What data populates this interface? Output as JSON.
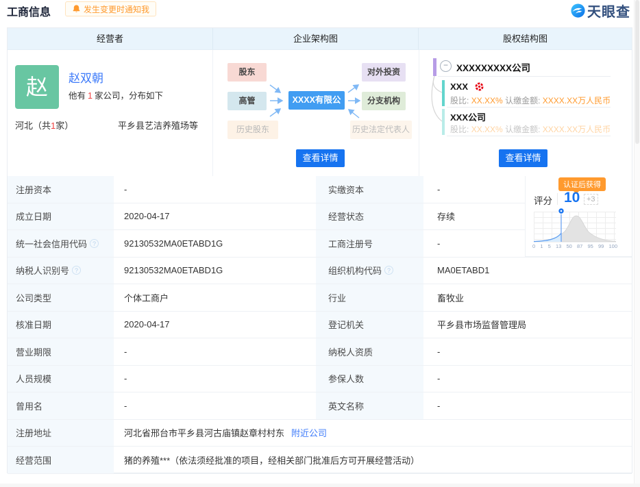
{
  "page": {
    "title": "工商信息",
    "notify_label": "发生变更时通知我",
    "logo_text": "天眼查"
  },
  "colors": {
    "accent_blue": "#1673f0",
    "link_blue": "#3e7bfa",
    "orange": "#ff9a2e",
    "avatar_green": "#68c6a2",
    "red": "#f04040",
    "header_bg": "#e9f4fc"
  },
  "headers": {
    "operator": "经营者",
    "org_chart": "企业架构图",
    "equity_chart": "股权结构图"
  },
  "operator": {
    "avatar_char": "赵",
    "name": "赵双朝",
    "desc_prefix": "他有",
    "desc_count": "1",
    "desc_suffix": "家公司，分布如下",
    "region_prefix": "河北（共",
    "region_count": "1",
    "region_suffix": "家）",
    "company": "平乡县艺洁养殖场等"
  },
  "org": {
    "left": [
      "股东",
      "高管",
      "历史股东"
    ],
    "center": "XXXX有限公司",
    "right": [
      "对外投资",
      "分支机构",
      "历史法定代表人"
    ],
    "detail_button": "查看详情"
  },
  "equity": {
    "root": "XXXXXXXXX公司",
    "children": [
      {
        "name": "XXX",
        "has_red_icon": true,
        "ratio_label": "股比:",
        "ratio": "XX.XX%",
        "amount_label": "认缴金额:",
        "amount": "XXXX.XX万人民币",
        "faded": false
      },
      {
        "name": "XXX公司",
        "has_red_icon": false,
        "ratio_label": "股比:",
        "ratio": "XX.XX%",
        "amount_label": "认缴金额:",
        "amount": "XXXX.XX万人民币",
        "faded": true
      }
    ],
    "detail_button": "查看详情"
  },
  "score": {
    "badge": "认证后获得",
    "label": "评分",
    "value": "10",
    "bonus": "+3",
    "axis": [
      "0",
      "1",
      "5",
      "13",
      "50",
      "87",
      "95",
      "99",
      "100"
    ]
  },
  "table": {
    "rows": [
      {
        "l1": "注册资本",
        "h1": false,
        "v1": "-",
        "l2": "实缴资本",
        "h2": false,
        "v2": "-"
      },
      {
        "l1": "成立日期",
        "h1": false,
        "v1": "2020-04-17",
        "l2": "经营状态",
        "h2": false,
        "v2": "存续"
      },
      {
        "l1": "统一社会信用代码",
        "h1": true,
        "v1": "92130532MA0ETABD1G",
        "l2": "工商注册号",
        "h2": false,
        "v2": "-"
      },
      {
        "l1": "纳税人识别号",
        "h1": true,
        "v1": "92130532MA0ETABD1G",
        "l2": "组织机构代码",
        "h2": true,
        "v2": "MA0ETABD1"
      },
      {
        "l1": "公司类型",
        "h1": false,
        "v1": "个体工商户",
        "l2": "行业",
        "h2": false,
        "v2": "畜牧业"
      },
      {
        "l1": "核准日期",
        "h1": false,
        "v1": "2020-04-17",
        "l2": "登记机关",
        "h2": false,
        "v2": "平乡县市场监督管理局"
      },
      {
        "l1": "营业期限",
        "h1": false,
        "v1": "-",
        "l2": "纳税人资质",
        "h2": false,
        "v2": "-"
      },
      {
        "l1": "人员规模",
        "h1": false,
        "v1": "-",
        "l2": "参保人数",
        "h2": false,
        "v2": "-"
      },
      {
        "l1": "曾用名",
        "h1": false,
        "v1": "-",
        "l2": "英文名称",
        "h2": false,
        "v2": "-"
      },
      {
        "full": true,
        "l1": "注册地址",
        "h1": false,
        "v1": "河北省邢台市平乡县河古庙镇赵章村村东",
        "link": "附近公司"
      },
      {
        "full": true,
        "l1": "经营范围",
        "h1": false,
        "v1": "猪的养殖***（依法须经批准的项目，经相关部门批准后方可开展经营活动）"
      }
    ]
  }
}
